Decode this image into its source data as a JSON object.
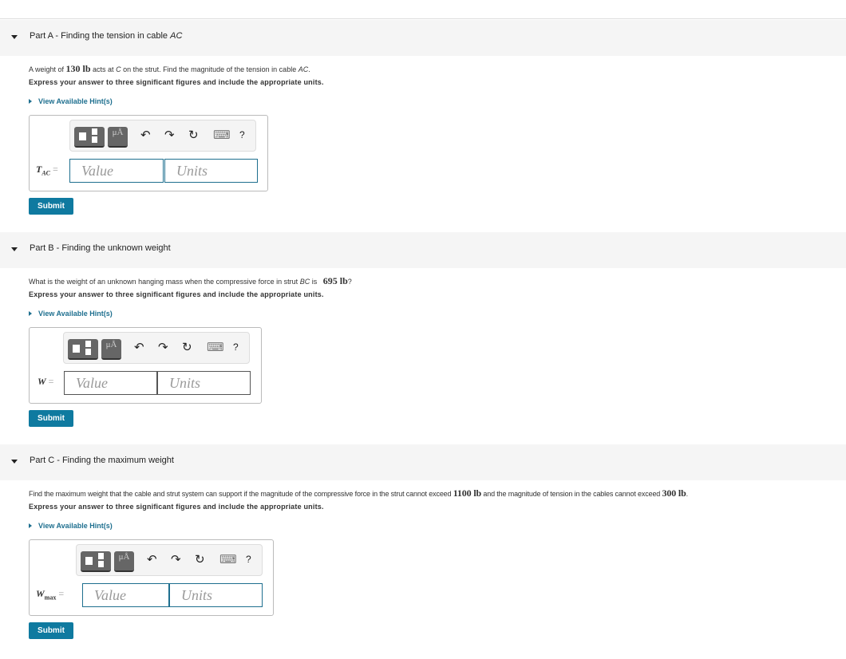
{
  "parts": [
    {
      "title": "Part A - Finding the tension in cable ",
      "title_var": "AC",
      "question": [
        "A weight of ",
        "130 lb",
        " acts at ",
        "C",
        " on the strut. Find the magnitude of the tension in cable ",
        "AC",
        "."
      ],
      "express": "Express your answer to three significant figures and include the appropriate units.",
      "hint": "View Available Hint(s)",
      "var": "T",
      "sub": "AC",
      "value_placeholder": "Value",
      "units_placeholder": "Units",
      "submit": "Submit"
    },
    {
      "title": "Part B - Finding the unknown weight",
      "title_var": "",
      "question": [
        "What is the weight of an unknown hanging mass when the compressive force in strut ",
        "BC",
        " is ",
        "695 lb",
        "?"
      ],
      "express": "Express your answer to three significant figures and include the appropriate units.",
      "hint": "View Available Hint(s)",
      "var": "W",
      "sub": "",
      "value_placeholder": "Value",
      "units_placeholder": "Units",
      "submit": "Submit"
    },
    {
      "title": "Part C - Finding the maximum weight",
      "title_var": "",
      "question": [
        "Find the maximum weight that the cable and strut system can support if the magnitude of the compressive force in the strut cannot exceed ",
        "1100 lb",
        " and the magnitude of tension in the cables cannot exceed ",
        "300 lb",
        "."
      ],
      "express": "Express your answer to three significant figures and include the appropriate units.",
      "hint": "View Available Hint(s)",
      "var": "W",
      "sub": "max",
      "value_placeholder": "Value",
      "units_placeholder": "Units",
      "submit": "Submit"
    }
  ],
  "toolbar": {
    "units_btn": "μÅ",
    "undo": "↶",
    "redo": "↷",
    "reset": "↻",
    "keyboard": "⌨",
    "help": "?"
  },
  "colors": {
    "accent": "#0f7aa0",
    "link": "#1e6f8f",
    "header_bg": "#f5f5f5"
  }
}
